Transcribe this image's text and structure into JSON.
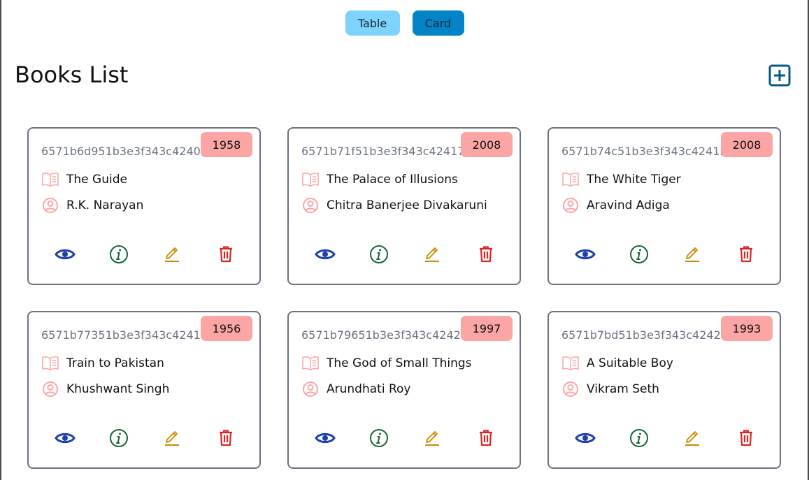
{
  "view_toggle": {
    "table_label": "Table",
    "card_label": "Card"
  },
  "header": {
    "title": "Books List"
  },
  "icons": {
    "add": "plus-square-icon",
    "title": "open-book-icon",
    "author": "user-circle-icon",
    "show": "eye-icon",
    "info": "info-circle-icon",
    "edit": "pencil-icon",
    "delete": "trash-icon"
  },
  "colors": {
    "toggle_table": "#7dd3fc",
    "toggle_card": "#0284c7",
    "year_badge": "#fca5a5",
    "add_icon": "#075985",
    "show_icon": "#1e40af",
    "info_icon": "#166534",
    "edit_icon": "#ca8a04",
    "delete_icon": "#dc2626",
    "meta_icon": "#fca5a5"
  },
  "books": [
    {
      "id": "6571b6d951b3e3f343c4240a",
      "year": "1958",
      "title": "The Guide",
      "author": "R.K. Narayan"
    },
    {
      "id": "6571b71f51b3e3f343c42417",
      "year": "2008",
      "title": "The Palace of Illusions",
      "author": "Chitra Banerjee Divakaruni"
    },
    {
      "id": "6571b74c51b3e3f343c4241b",
      "year": "2008",
      "title": "The White Tiger",
      "author": "Aravind Adiga"
    },
    {
      "id": "6571b77351b3e3f343c4241f",
      "year": "1956",
      "title": "Train to Pakistan",
      "author": "Khushwant Singh"
    },
    {
      "id": "6571b79651b3e3f343c42423",
      "year": "1997",
      "title": "The God of Small Things",
      "author": "Arundhati Roy"
    },
    {
      "id": "6571b7bd51b3e3f343c42427",
      "year": "1993",
      "title": "A Suitable Boy",
      "author": "Vikram Seth"
    }
  ]
}
